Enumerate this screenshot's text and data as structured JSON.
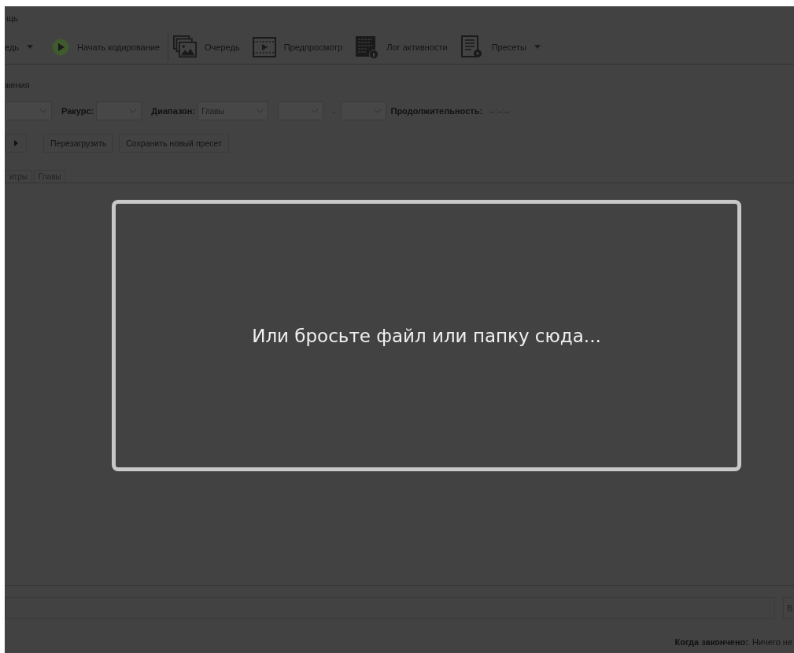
{
  "menu": {
    "items": [
      "щь"
    ]
  },
  "toolbar": {
    "items": [
      {
        "kind": "menu",
        "label": "едь",
        "caret": true
      },
      {
        "kind": "start",
        "label": "Начать кодирование",
        "caret": false
      },
      {
        "kind": "queue",
        "label": "Очередь",
        "caret": false
      },
      {
        "kind": "preview",
        "label": "Предпросмотр",
        "caret": false
      },
      {
        "kind": "log",
        "label": "Лог активности",
        "caret": false
      },
      {
        "kind": "presets",
        "label": "Пресеты",
        "caret": true
      }
    ]
  },
  "source": {
    "title": "жения",
    "controls": [
      {
        "kind": "combo"
      },
      {
        "kind": "label",
        "text": "Ракурс:"
      },
      {
        "kind": "combo"
      },
      {
        "kind": "label",
        "text": "Диапазон:"
      },
      {
        "kind": "combo",
        "value": "Главы"
      },
      {
        "kind": "combo"
      },
      {
        "kind": "text",
        "text": "-"
      },
      {
        "kind": "combo"
      },
      {
        "kind": "label",
        "text": "Продолжительность:"
      },
      {
        "kind": "text",
        "text": "--:--:--"
      }
    ]
  },
  "preset_buttons": [
    {
      "kind": "arrow"
    },
    {
      "kind": "text",
      "label": "Перезагрузить"
    },
    {
      "kind": "text",
      "label": "Сохранить новый пресет"
    }
  ],
  "tabs": [
    {
      "label": "итры",
      "selected": false
    },
    {
      "label": "Главы",
      "selected": false
    }
  ],
  "destination": {
    "button": "В"
  },
  "status_bar": {
    "label": "Когда закончено:",
    "value": "Ничего не"
  },
  "drop_zone": {
    "message": "Или бросьте файл или папку сюда..."
  }
}
